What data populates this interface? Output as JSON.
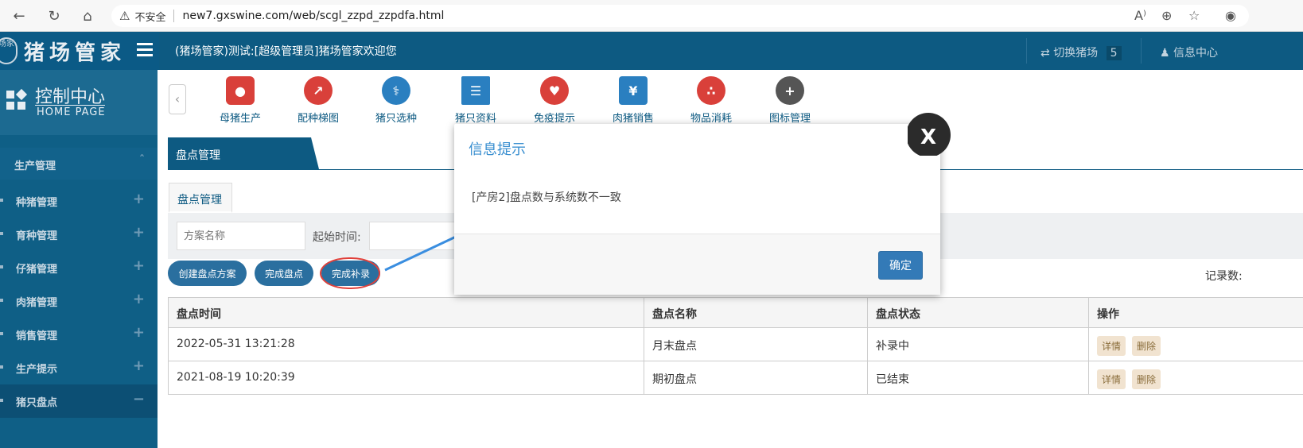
{
  "browser": {
    "insecure_label": "不安全",
    "url": "new7.gxswine.com/web/scgl_zzpd_zzpdfa.html"
  },
  "header": {
    "logo_text": "猪场管家",
    "logo_seal": "场家",
    "welcome": "(猪场管家)测试:[超级管理员]猪场管家欢迎您",
    "switch_farm": "切换猪场",
    "farm_count": "5",
    "info_center": "信息中心"
  },
  "sidebar": {
    "control_title": "控制中心",
    "control_sub": "HOME PAGE",
    "group": "生产管理",
    "items": [
      {
        "label": "种猪管理",
        "sign": "+"
      },
      {
        "label": "育种管理",
        "sign": "+"
      },
      {
        "label": "仔猪管理",
        "sign": "+"
      },
      {
        "label": "肉猪管理",
        "sign": "+"
      },
      {
        "label": "销售管理",
        "sign": "+"
      },
      {
        "label": "生产提示",
        "sign": "+"
      },
      {
        "label": "猪只盘点",
        "sign": "−"
      }
    ]
  },
  "quick": [
    {
      "label": "母猪生产",
      "icon": "pig-icon",
      "color": "#d9403a"
    },
    {
      "label": "配种梯图",
      "icon": "stairs-icon",
      "color": "#d9403a"
    },
    {
      "label": "猪只选种",
      "icon": "flask-icon",
      "color": "#2a7fc0"
    },
    {
      "label": "猪只资料",
      "icon": "book-icon",
      "color": "#2a7fc0"
    },
    {
      "label": "免疫提示",
      "icon": "heart-icon",
      "color": "#d9403a"
    },
    {
      "label": "肉猪销售",
      "icon": "money-icon",
      "color": "#2a7fc0"
    },
    {
      "label": "物品消耗",
      "icon": "balls-icon",
      "color": "#d9403a"
    },
    {
      "label": "图标管理",
      "icon": "plus-icon",
      "color": "#555555"
    }
  ],
  "main": {
    "panel_tab": "盘点管理",
    "subtab": "盘点管理",
    "plan_placeholder": "方案名称",
    "start_time_label": "起始时间:",
    "buttons": {
      "create": "创建盘点方案",
      "finish": "完成盘点",
      "supplement": "完成补录"
    },
    "records_label": "记录数:",
    "table": {
      "headers": [
        "盘点时间",
        "盘点名称",
        "盘点状态",
        "操作"
      ],
      "rows": [
        {
          "time": "2022-05-31 13:21:28",
          "name": "月末盘点",
          "status": "补录中"
        },
        {
          "time": "2021-08-19 10:20:39",
          "name": "期初盘点",
          "status": "已结束"
        }
      ],
      "op_detail": "详情",
      "op_delete": "删除"
    }
  },
  "dialog": {
    "title": "信息提示",
    "message": "[产房2]盘点数与系统数不一致",
    "ok": "确定",
    "close": "X"
  }
}
